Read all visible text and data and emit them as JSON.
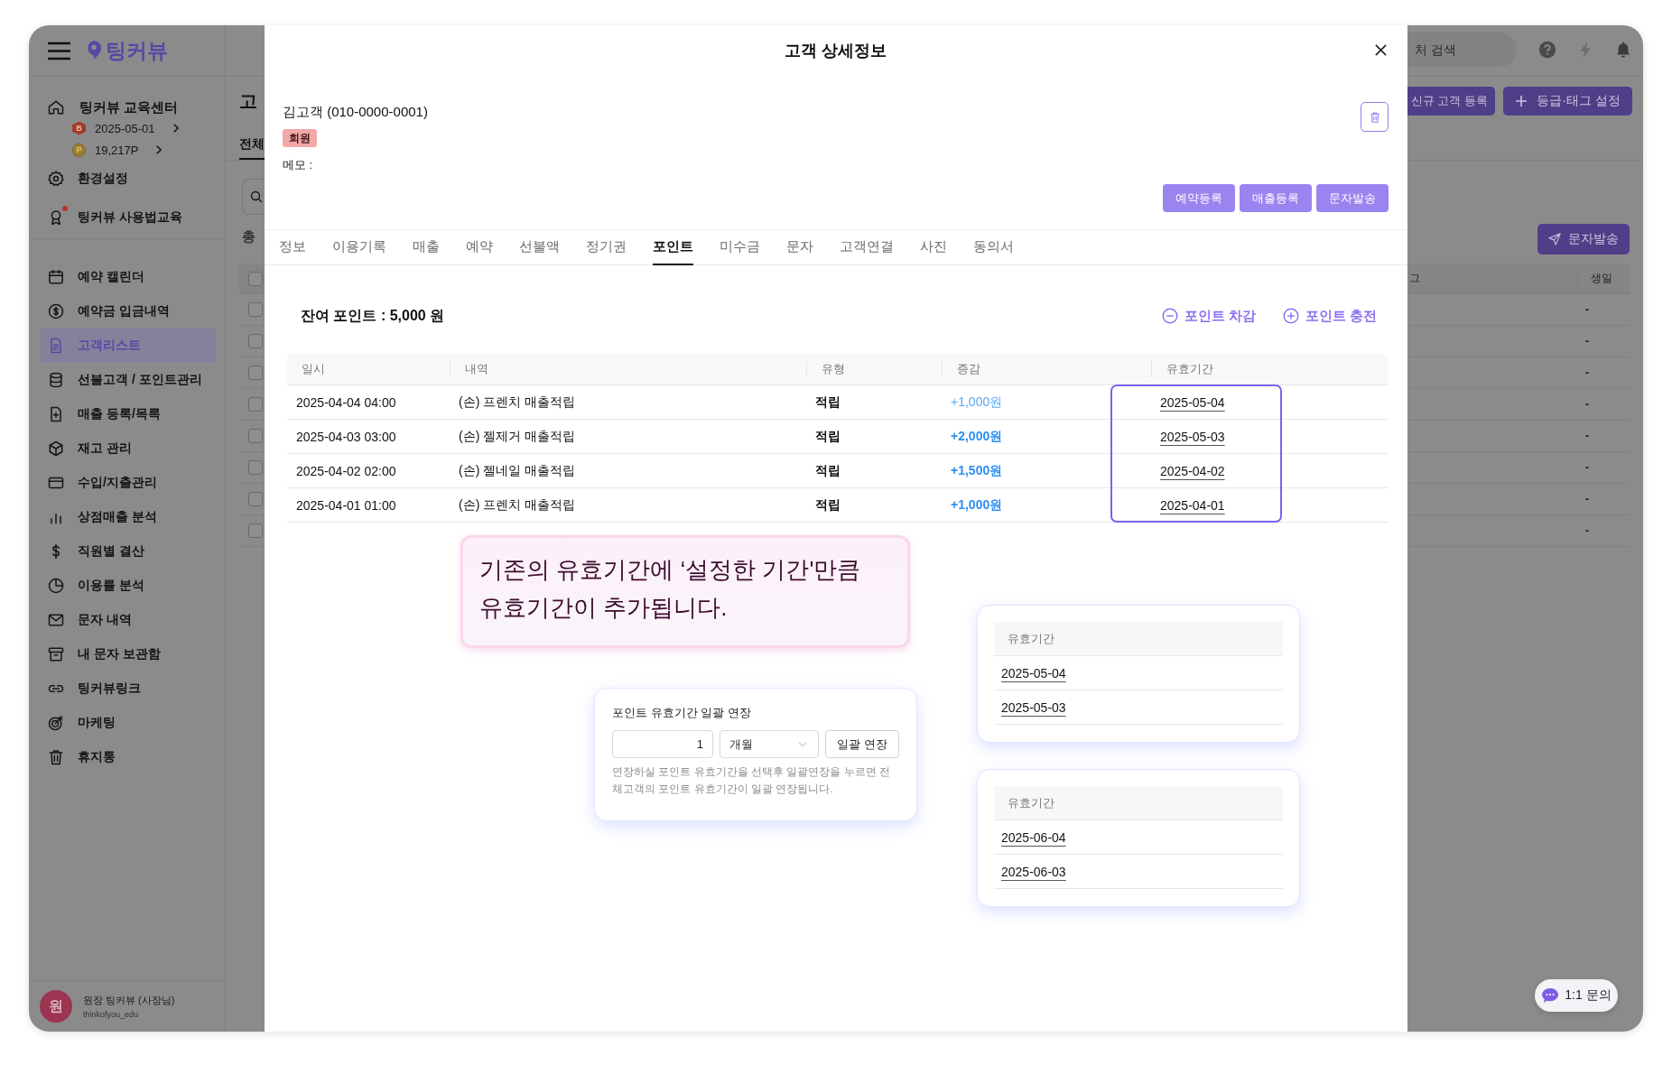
{
  "sidebar": {
    "logo": "팅커뷰",
    "store": {
      "name": "팅커뷰 교육센터",
      "grade_mark": "B",
      "date": "2025-05-01",
      "point_mark": "P",
      "points": "19,217P"
    },
    "top_items": [
      {
        "label": "환경설정",
        "selected": false,
        "notification": false
      },
      {
        "label": "팅커뷰 사용법교육",
        "selected": false,
        "notification": true
      }
    ],
    "menu_items": [
      {
        "label": "예약 캘린더",
        "selected": false
      },
      {
        "label": "예약금 입금내역",
        "selected": false
      },
      {
        "label": "고객리스트",
        "selected": true
      },
      {
        "label": "선불고객 / 포인트관리",
        "selected": false
      },
      {
        "label": "매출 등록/목록",
        "selected": false
      },
      {
        "label": "재고 관리",
        "selected": false
      },
      {
        "label": "수입/지출관리",
        "selected": false
      },
      {
        "label": "상점매출 분석",
        "selected": false
      },
      {
        "label": "직원별 결산",
        "selected": false
      },
      {
        "label": "이용률 분석",
        "selected": false
      },
      {
        "label": "문자 내역",
        "selected": false
      },
      {
        "label": "내 문자 보관함",
        "selected": false
      },
      {
        "label": "팅커뷰링크",
        "selected": false
      },
      {
        "label": "마케팅",
        "selected": false
      },
      {
        "label": "휴지통",
        "selected": false
      }
    ],
    "user": {
      "avatar": "원",
      "name": "원장 팅커뷰 (사장님)",
      "id": "thinkofyou_edu"
    }
  },
  "background": {
    "title": "고",
    "tabs": [
      {
        "label": "전체",
        "selected": true
      }
    ],
    "search_placeholder": "처 검색",
    "total": "총",
    "register_button": "신규 고객 등록",
    "tag_button": "등급·태그 설정",
    "send_button": "문자발송",
    "table": {
      "columns": [
        "그",
        "생일"
      ],
      "header_checked": false,
      "rows": [
        {
          "checked": false,
          "birthday": "-"
        },
        {
          "checked": false,
          "birthday": "-"
        },
        {
          "checked": false,
          "birthday": "-"
        },
        {
          "checked": false,
          "birthday": "-"
        },
        {
          "checked": false,
          "birthday": "-"
        },
        {
          "checked": false,
          "birthday": "-"
        },
        {
          "checked": false,
          "birthday": "-"
        },
        {
          "checked": false,
          "birthday": "-"
        }
      ]
    }
  },
  "modal": {
    "title": "고객 상세정보",
    "customer": {
      "name": "김고객 (010-0000-0001)",
      "badge": "회원",
      "memo_label": "메모 :"
    },
    "actions": [
      "예약등록",
      "매출등록",
      "문자발송"
    ],
    "tabs": [
      {
        "label": "정보",
        "selected": false
      },
      {
        "label": "이용기록",
        "selected": false
      },
      {
        "label": "매출",
        "selected": false
      },
      {
        "label": "예약",
        "selected": false
      },
      {
        "label": "선불액",
        "selected": false
      },
      {
        "label": "정기권",
        "selected": false
      },
      {
        "label": "포인트",
        "selected": true
      },
      {
        "label": "미수금",
        "selected": false
      },
      {
        "label": "문자",
        "selected": false
      },
      {
        "label": "고객연결",
        "selected": false
      },
      {
        "label": "사진",
        "selected": false
      },
      {
        "label": "동의서",
        "selected": false
      }
    ],
    "balance": "잔여 포인트 : 5,000 원",
    "point_actions": [
      {
        "label": "포인트 차감",
        "kind": "minus"
      },
      {
        "label": "포인트 충전",
        "kind": "plus"
      }
    ],
    "table": {
      "columns": [
        "일시",
        "내역",
        "유형",
        "증감",
        "유효기간"
      ],
      "highlight_expiry": true,
      "rows": [
        {
          "date": "2025-04-04 04:00",
          "description": "(손) 프렌치 매출적립",
          "type": "적립",
          "amount": "+1,000원",
          "emphasized": false,
          "expiry": "2025-05-04"
        },
        {
          "date": "2025-04-03 03:00",
          "description": "(손) 젤제거 매출적립",
          "type": "적립",
          "amount": "+2,000원",
          "emphasized": true,
          "expiry": "2025-05-03"
        },
        {
          "date": "2025-04-02 02:00",
          "description": "(손) 젤네일 매출적립",
          "type": "적립",
          "amount": "+1,500원",
          "emphasized": true,
          "expiry": "2025-04-02"
        },
        {
          "date": "2025-04-01 01:00",
          "description": "(손) 프렌치 매출적립",
          "type": "적립",
          "amount": "+1,000원",
          "emphasized": true,
          "expiry": "2025-04-01"
        }
      ]
    },
    "callout": "기존의 유효기간에 ‘설정한 기간'만큼\n유효기간이 추가됩니다.",
    "extension": {
      "title": "포인트 유효기간 일괄 연장",
      "amount": "1",
      "unit": "개월",
      "button": "일괄 연장",
      "help": "연장하실 포인트 유효기간을 선택후 일괄연장을 누르면 전체고객의 포인트 유효기간이 일괄 연장됩니다."
    },
    "compare_cards": [
      {
        "header": "유효기간",
        "dates": [
          "2025-05-04",
          "2025-05-03"
        ]
      },
      {
        "header": "유효기간",
        "dates": [
          "2025-06-04",
          "2025-06-03"
        ]
      }
    ]
  },
  "chat_button": "1:1 문의"
}
